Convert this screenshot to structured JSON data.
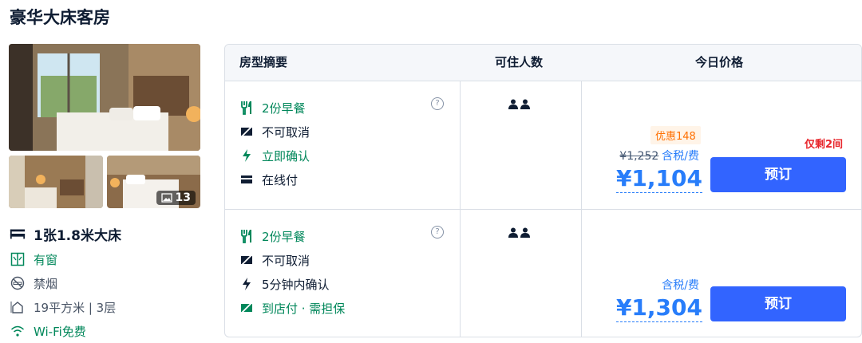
{
  "room": {
    "title": "豪华大床客房",
    "photo_count": "13",
    "bed": "1张1.8米大床",
    "window": "有窗",
    "smoking": "禁烟",
    "size_floor": "19平方米 | 3层",
    "wifi": "Wi-Fi免费"
  },
  "table": {
    "headers": [
      "房型摘要",
      "可住人数",
      "今日价格"
    ]
  },
  "offers": [
    {
      "breakfast": "2份早餐",
      "cancel": "不可取消",
      "confirm": "立即确认",
      "payment": "在线付",
      "discount": "优惠148",
      "original_price": "¥1,252",
      "tax_label": "含税/费",
      "price": "¥1,104",
      "rooms_left": "仅剩2间",
      "book_label": "预订"
    },
    {
      "breakfast": "2份早餐",
      "cancel": "不可取消",
      "confirm": "5分钟内确认",
      "payment": "到店付 · 需担保",
      "tax_label": "含税/费",
      "price": "¥1,304",
      "book_label": "预订"
    }
  ],
  "colors": {
    "accent": "#287dfa",
    "button": "#3264ff",
    "green": "#00875a",
    "discount": "#ff6f00",
    "alert": "#e8262c"
  }
}
